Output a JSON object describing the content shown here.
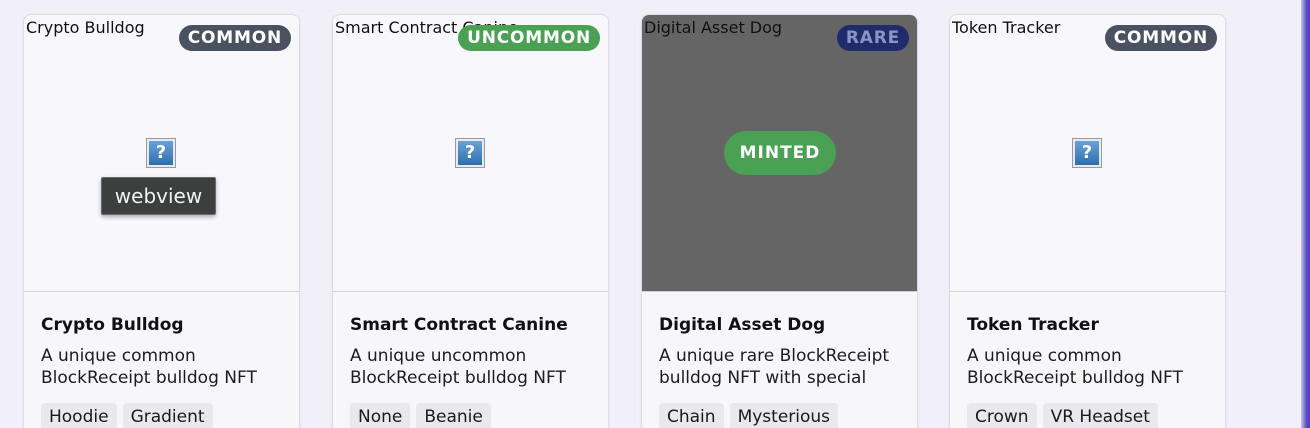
{
  "cards": [
    {
      "image_alt": "Crypto Bulldog",
      "badge": "COMMON",
      "title": "Crypto Bulldog",
      "description": "A unique common BlockReceipt bulldog NFT",
      "tags": [
        "Hoodie",
        "Gradient"
      ]
    },
    {
      "image_alt": "Smart Contract Canine",
      "badge": "UNCOMMON",
      "title": "Smart Contract Canine",
      "description": "A unique uncommon BlockReceipt bulldog NFT",
      "tags": [
        "None",
        "Beanie"
      ]
    },
    {
      "image_alt": "Digital Asset Dog",
      "badge": "RARE",
      "status": "MINTED",
      "title": "Digital Asset Dog",
      "description": "A unique rare BlockReceipt bulldog NFT with special",
      "tags": [
        "Chain",
        "Mysterious"
      ]
    },
    {
      "image_alt": "Token Tracker",
      "badge": "COMMON",
      "title": "Token Tracker",
      "description": "A unique common BlockReceipt bulldog NFT",
      "tags": [
        "Crown",
        "VR Headset"
      ]
    }
  ],
  "tooltip": "webview",
  "icons": {
    "broken_image": "broken-image-icon"
  },
  "colors": {
    "common_badge": "#4a5160",
    "uncommon_badge": "#4aa153",
    "rare_badge": "#1f2b6b",
    "minted": "#4aa153"
  }
}
